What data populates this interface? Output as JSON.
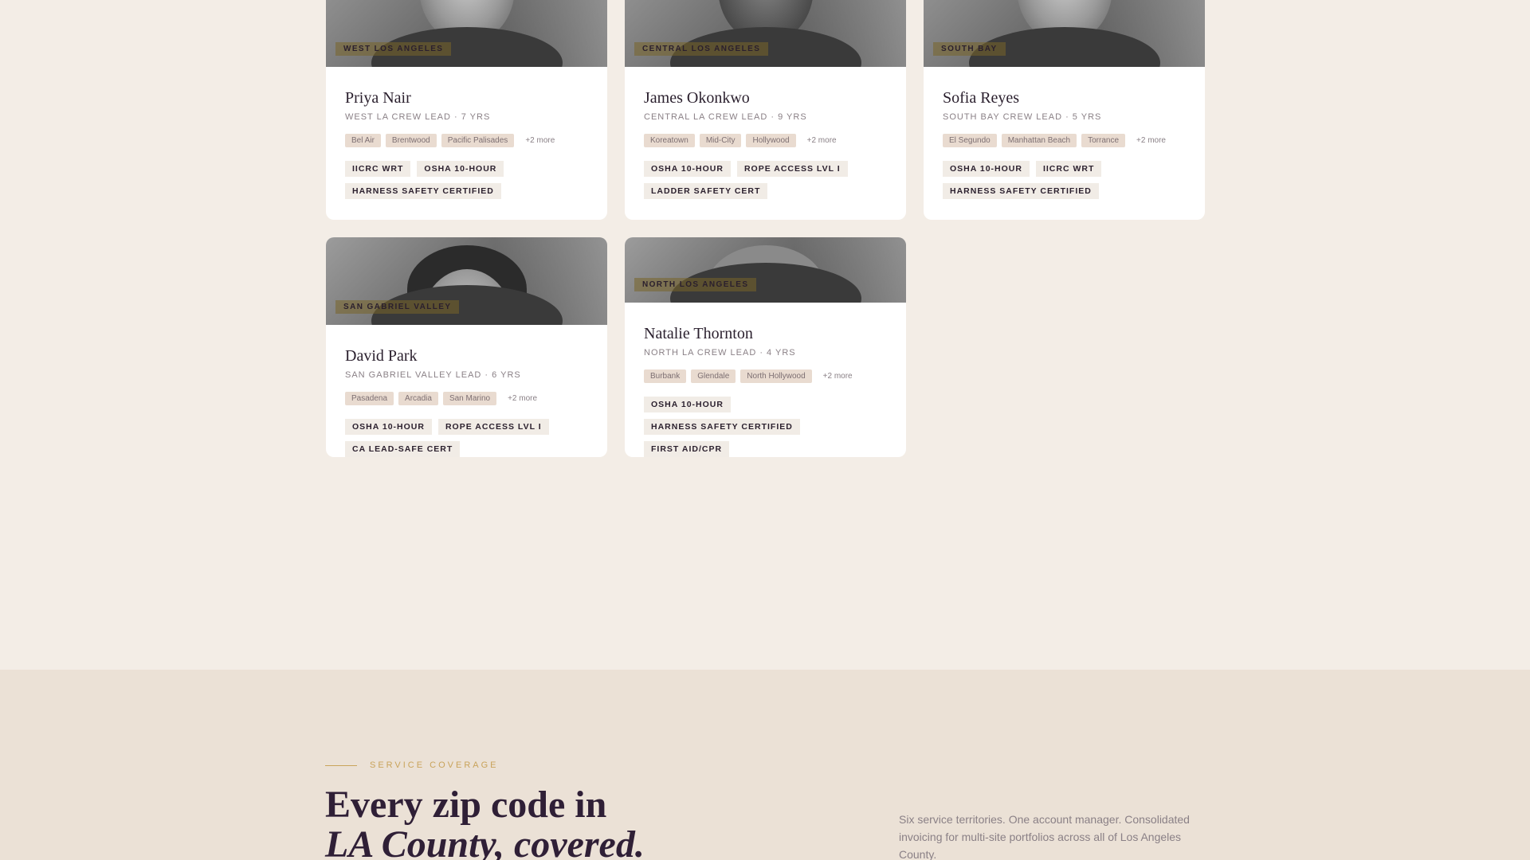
{
  "team": [
    {
      "region": "West Los Angeles",
      "name": "Priya Nair",
      "role": "West LA Crew Lead · 7 yrs",
      "areas": [
        "Bel Air",
        "Brentwood",
        "Pacific Palisades"
      ],
      "more": "+2 more",
      "certs": [
        "IICRC WRT",
        "OSHA 10-Hour",
        "Harness Safety Certified"
      ]
    },
    {
      "region": "Central Los Angeles",
      "name": "James Okonkwo",
      "role": "Central LA Crew Lead · 9 yrs",
      "areas": [
        "Koreatown",
        "Mid-City",
        "Hollywood"
      ],
      "more": "+2 more",
      "certs": [
        "OSHA 10-Hour",
        "Rope Access Lvl I",
        "Ladder Safety Cert"
      ]
    },
    {
      "region": "South Bay",
      "name": "Sofia Reyes",
      "role": "South Bay Crew Lead · 5 yrs",
      "areas": [
        "El Segundo",
        "Manhattan Beach",
        "Torrance"
      ],
      "more": "+2 more",
      "certs": [
        "OSHA 10-Hour",
        "IICRC WRT",
        "Harness Safety Certified"
      ]
    },
    {
      "region": "San Gabriel Valley",
      "name": "David Park",
      "role": "San Gabriel Valley Lead · 6 yrs",
      "areas": [
        "Pasadena",
        "Arcadia",
        "San Marino"
      ],
      "more": "+2 more",
      "certs": [
        "OSHA 10-Hour",
        "Rope Access Lvl I",
        "CA Lead-Safe Cert"
      ]
    },
    {
      "region": "North Los Angeles",
      "name": "Natalie Thornton",
      "role": "North LA Crew Lead · 4 yrs",
      "areas": [
        "Burbank",
        "Glendale",
        "North Hollywood"
      ],
      "more": "+2 more",
      "certs": [
        "OSHA 10-Hour",
        "Harness Safety Certified",
        "First Aid/CPR"
      ]
    }
  ],
  "coverage": {
    "eyebrow": "Service Coverage",
    "headline_line1": "Every zip code in",
    "headline_line2": "LA County, covered.",
    "description": "Six service territories. One account manager. Consolidated invoicing for multi-site portfolios across all of Los Angeles County."
  },
  "colors": {
    "page_bg": "#f3ede6",
    "coverage_bg": "#ebe1d6",
    "accent_gold": "#c9a35a",
    "heading_plum": "#2f1f36"
  }
}
